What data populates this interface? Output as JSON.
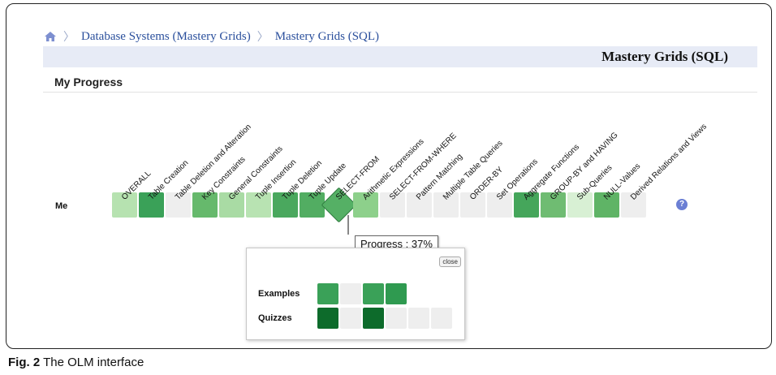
{
  "breadcrumb": {
    "items": [
      "Database Systems (Mastery Grids)",
      "Mastery Grids (SQL)"
    ],
    "home_icon": "home-icon"
  },
  "header": {
    "title": "Mastery Grids (SQL)"
  },
  "section": {
    "heading": "My Progress"
  },
  "grid": {
    "row_label": "Me",
    "topics": [
      {
        "label": "OVERALL",
        "color": "#b6e2b0"
      },
      {
        "label": "Table Creation",
        "color": "#3aa158"
      },
      {
        "label": "Table Deletion and Alteration",
        "color": "#eeeeee"
      },
      {
        "label": "Key Constraints",
        "color": "#66b96c"
      },
      {
        "label": "General Constraints",
        "color": "#a9dba4"
      },
      {
        "label": "Tuple Insertion",
        "color": "#b8e3b2"
      },
      {
        "label": "Tuple Deletion",
        "color": "#4aa85e"
      },
      {
        "label": "Tuple Update",
        "color": "#52ad62"
      },
      {
        "label": "SELECT-FROM",
        "color": "#55b065"
      },
      {
        "label": "Arithmetic Expressions",
        "color": "#8dd08b"
      },
      {
        "label": "SELECT-FROM-WHERE",
        "color": "#eeeeee"
      },
      {
        "label": "Pattern Matching",
        "color": "#eeeeee"
      },
      {
        "label": "Multiple Table Queries",
        "color": "#eeeeee"
      },
      {
        "label": "ORDER-BY",
        "color": "#eeeeee"
      },
      {
        "label": "Set Operations",
        "color": "#eeeeee"
      },
      {
        "label": "Aggregate Functions",
        "color": "#45a65b"
      },
      {
        "label": "GROUP-BY and HAVING",
        "color": "#6fbc72"
      },
      {
        "label": "Sub-Queries",
        "color": "#d8f0d4"
      },
      {
        "label": "NULL-Values",
        "color": "#5fb466"
      },
      {
        "label": "Derived Relations and Views",
        "color": "#eeeeee"
      }
    ],
    "help_icon": "help-icon"
  },
  "tooltip": {
    "text": "Progress : 37%",
    "progress_percent": 37
  },
  "popup": {
    "close_label": "close",
    "rows": [
      {
        "label": "Examples",
        "colors": [
          "#3aa158",
          "#eeeeee",
          "#3aa158",
          "#2f9a50"
        ]
      },
      {
        "label": "Quizzes",
        "colors": [
          "#0d6b2b",
          "#eeeeee",
          "#0d6b2b",
          "#eeeeee",
          "#eeeeee",
          "#eeeeee"
        ]
      }
    ]
  },
  "caption": {
    "prefix": "Fig. 2",
    "text": " The OLM interface"
  }
}
